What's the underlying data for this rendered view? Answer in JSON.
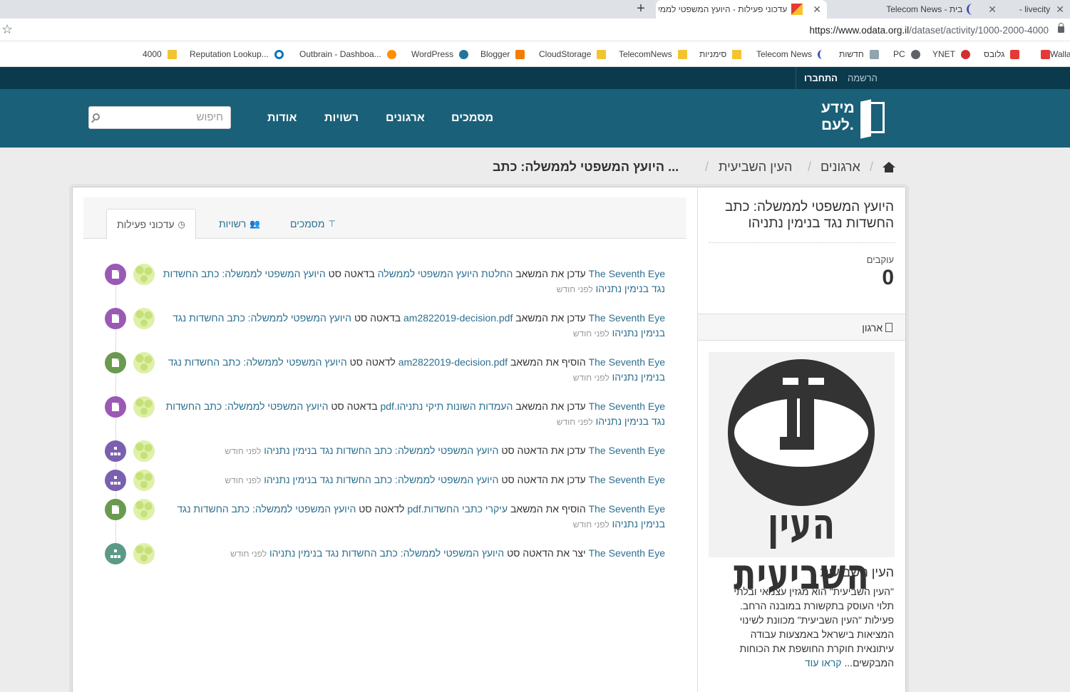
{
  "browser": {
    "tabs": [
      {
        "title": "livecity -",
        "close": "✕"
      },
      {
        "title": "בית - Telecom News",
        "close": "✕"
      },
      {
        "title": "עדכוני פעילות - היועץ המשפטי לממשלה: כ",
        "close": "✕"
      }
    ],
    "new_tab": "+",
    "url_domain": "https://www.odata.org.il",
    "url_path": "/dataset/activity/1000-2000-4000",
    "star": "☆",
    "bookmarks": [
      {
        "label": "Walla! Ma",
        "color": "#e53935"
      },
      {
        "label": "גלובס",
        "color": "#e53935"
      },
      {
        "label": "YNET",
        "color": "#d32f2f"
      },
      {
        "label": "PC",
        "color": "#5f6368"
      },
      {
        "label": "חדשות",
        "color": "#90a4ae"
      },
      {
        "label": "Telecom News",
        "color": "#3f51b5"
      },
      {
        "label": "סימניות",
        "color": "#f4c430"
      },
      {
        "label": "TelecomNews",
        "color": "#f4c430"
      },
      {
        "label": "CloudStorage",
        "color": "#f4c430"
      },
      {
        "label": "Blogger",
        "color": "#f57c00"
      },
      {
        "label": "WordPress",
        "color": "#21759b"
      },
      {
        "label": "Outbrain - Dashboa...",
        "color": "#ff8f00"
      },
      {
        "label": "Reputation Lookup...",
        "color": "#0277bd"
      },
      {
        "label": "4000",
        "color": "#f4c430"
      }
    ]
  },
  "site": {
    "signup": "הרשמה",
    "login": "התחברו",
    "logo_line1": "מידע",
    "logo_line2": "לעם.",
    "nav": [
      "מסמכים",
      "ארגונים",
      "רשויות",
      "אודות"
    ],
    "search_placeholder": "חיפוש"
  },
  "breadcrumb": {
    "items": [
      "ארגונים",
      "העין השביעית"
    ],
    "current": "היועץ המשפטי לממשלה: כתב ...",
    "separator": "/"
  },
  "sidebar": {
    "title": "היועץ המשפטי לממשלה: כתב החשדות נגד בנימין נתניהו",
    "followers_label": "עוקבים",
    "followers_count": "0",
    "org_section": "ארגון",
    "org_name": "העין השביעית",
    "org_logo_text": "העין השביעית",
    "org_description": "\"העין השביעית\" הוא מגזין עצמאי ובלתי תלוי העוסק בתקשורת במובנה הרחב. פעילות \"העין השביעית\" מכוונת לשינוי המציאות בישראל באמצעות עבודה עיתונאית חוקרת החושפת את הכוחות המבקשים...",
    "read_more": "קראו עוד"
  },
  "tabs": [
    {
      "label": "עדכוני פעילות",
      "icon": "clock-icon",
      "active": true
    },
    {
      "label": "רשויות",
      "icon": "users-icon",
      "active": false
    },
    {
      "label": "מסמכים",
      "icon": "sitemap-icon",
      "active": false
    }
  ],
  "activities": [
    {
      "type": "updated-resource",
      "badge_color": "#9b59b6",
      "user": "The Seventh Eye",
      "verb": "עדכן את המשאב",
      "resource": "החלטת היועץ המשפטי לממשלה",
      "prep": "בדאטה סט",
      "dataset": "היועץ המשפטי לממשלה: כתב החשדות נגד בנימין נתניהו",
      "time": "לפני חודש"
    },
    {
      "type": "updated-resource",
      "badge_color": "#9b59b6",
      "user": "The Seventh Eye",
      "verb": "עדכן את המשאב",
      "resource": "am2822019-decision.pdf",
      "prep": "בדאטה סט",
      "dataset": "היועץ המשפטי לממשלה: כתב החשדות נגד בנימין נתניהו",
      "time": "לפני חודש"
    },
    {
      "type": "added-resource",
      "badge_color": "#6a9a4f",
      "user": "The Seventh Eye",
      "verb": "הוסיף את המשאב",
      "resource": "am2822019-decision.pdf",
      "prep": "לדאטה סט",
      "dataset": "היועץ המשפטי לממשלה: כתב החשדות נגד בנימין נתניהו",
      "time": "לפני חודש"
    },
    {
      "type": "updated-resource",
      "badge_color": "#9b59b6",
      "user": "The Seventh Eye",
      "verb": "עדכן את המשאב",
      "resource": "העמדות השונות תיקי נתניהו.pdf",
      "prep": "בדאטה סט",
      "dataset": "היועץ המשפטי לממשלה: כתב החשדות נגד בנימין נתניהו",
      "time": "לפני חודש"
    },
    {
      "type": "updated-dataset",
      "badge_color": "#7b5fb0",
      "user": "The Seventh Eye",
      "verb": "עדכן את הדאטה סט",
      "resource": "",
      "prep": "",
      "dataset": "היועץ המשפטי לממשלה: כתב החשדות נגד בנימין נתניהו",
      "time": "לפני חודש"
    },
    {
      "type": "updated-dataset",
      "badge_color": "#7b5fb0",
      "user": "The Seventh Eye",
      "verb": "עדכן את הדאטה סט",
      "resource": "",
      "prep": "",
      "dataset": "היועץ המשפטי לממשלה: כתב החשדות נגד בנימין נתניהו",
      "time": "לפני חודש"
    },
    {
      "type": "added-resource",
      "badge_color": "#6a9a4f",
      "user": "The Seventh Eye",
      "verb": "הוסיף את המשאב",
      "resource": "עיקרי כתבי החשדות.pdf",
      "prep": "לדאטה סט",
      "dataset": "היועץ המשפטי לממשלה: כתב החשדות נגד בנימין נתניהו",
      "time": "לפני חודש"
    },
    {
      "type": "created-dataset",
      "badge_color": "#5b9a86",
      "user": "The Seventh Eye",
      "verb": "יצר את הדאטה סט",
      "resource": "",
      "prep": "",
      "dataset": "היועץ המשפטי לממשלה: כתב החשדות נגד בנימין נתניהו",
      "time": "לפני חודש"
    }
  ]
}
